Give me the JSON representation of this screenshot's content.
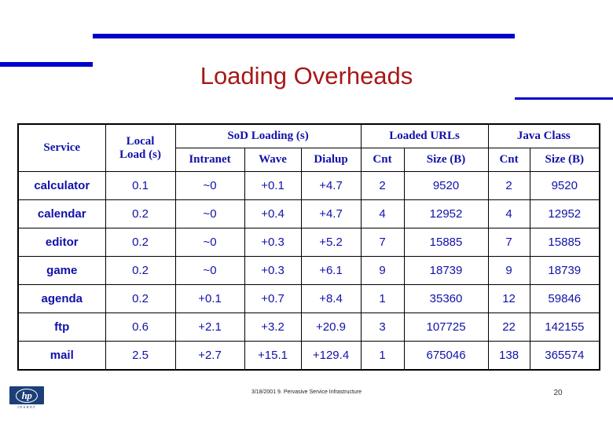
{
  "slide": {
    "title": "Loading Overheads",
    "title_color": "#A81818",
    "accent_color": "#0000CC",
    "text_color": "#1111AA",
    "page_number": "20",
    "footer_note": "3/18/2001  9. Pervasive Service Infrastructure"
  },
  "logo": {
    "name": "hp-invent-logo",
    "wordmark": "hp",
    "tagline": "invent",
    "trademark": "™",
    "box_color": "#1C3F77"
  },
  "table": {
    "header": {
      "group_row": [
        {
          "label": "Service",
          "colspan": 1,
          "rowspan": 2
        },
        {
          "label": "Local Load (s)",
          "line1": "Local",
          "line2": "Load (s)",
          "colspan": 1,
          "rowspan": 2
        },
        {
          "label": "SoD Loading (s)",
          "colspan": 3,
          "rowspan": 1
        },
        {
          "label": "Loaded URLs",
          "colspan": 2,
          "rowspan": 1
        },
        {
          "label": "Java Class",
          "colspan": 2,
          "rowspan": 1
        }
      ],
      "sub_row": [
        "Intranet",
        "Wave",
        "Dialup",
        "Cnt",
        "Size (B)",
        "Cnt",
        "Size (B)"
      ]
    },
    "rows": [
      {
        "service": "calculator",
        "local_load": "0.1",
        "sod_intranet": "~0",
        "sod_wave": "+0.1",
        "sod_dialup": "+4.7",
        "urls_cnt": "2",
        "urls_size": "9520",
        "java_cnt": "2",
        "java_size": "9520"
      },
      {
        "service": "calendar",
        "local_load": "0.2",
        "sod_intranet": "~0",
        "sod_wave": "+0.4",
        "sod_dialup": "+4.7",
        "urls_cnt": "4",
        "urls_size": "12952",
        "java_cnt": "4",
        "java_size": "12952"
      },
      {
        "service": "editor",
        "local_load": "0.2",
        "sod_intranet": "~0",
        "sod_wave": "+0.3",
        "sod_dialup": "+5.2",
        "urls_cnt": "7",
        "urls_size": "15885",
        "java_cnt": "7",
        "java_size": "15885"
      },
      {
        "service": "game",
        "local_load": "0.2",
        "sod_intranet": "~0",
        "sod_wave": "+0.3",
        "sod_dialup": "+6.1",
        "urls_cnt": "9",
        "urls_size": "18739",
        "java_cnt": "9",
        "java_size": "18739"
      },
      {
        "service": "agenda",
        "local_load": "0.2",
        "sod_intranet": "+0.1",
        "sod_wave": "+0.7",
        "sod_dialup": "+8.4",
        "urls_cnt": "1",
        "urls_size": "35360",
        "java_cnt": "12",
        "java_size": "59846"
      },
      {
        "service": "ftp",
        "local_load": "0.6",
        "sod_intranet": "+2.1",
        "sod_wave": "+3.2",
        "sod_dialup": "+20.9",
        "urls_cnt": "3",
        "urls_size": "107725",
        "java_cnt": "22",
        "java_size": "142155"
      },
      {
        "service": "mail",
        "local_load": "2.5",
        "sod_intranet": "+2.7",
        "sod_wave": "+15.1",
        "sod_dialup": "+129.4",
        "urls_cnt": "1",
        "urls_size": "675046",
        "java_cnt": "138",
        "java_size": "365574"
      }
    ]
  }
}
